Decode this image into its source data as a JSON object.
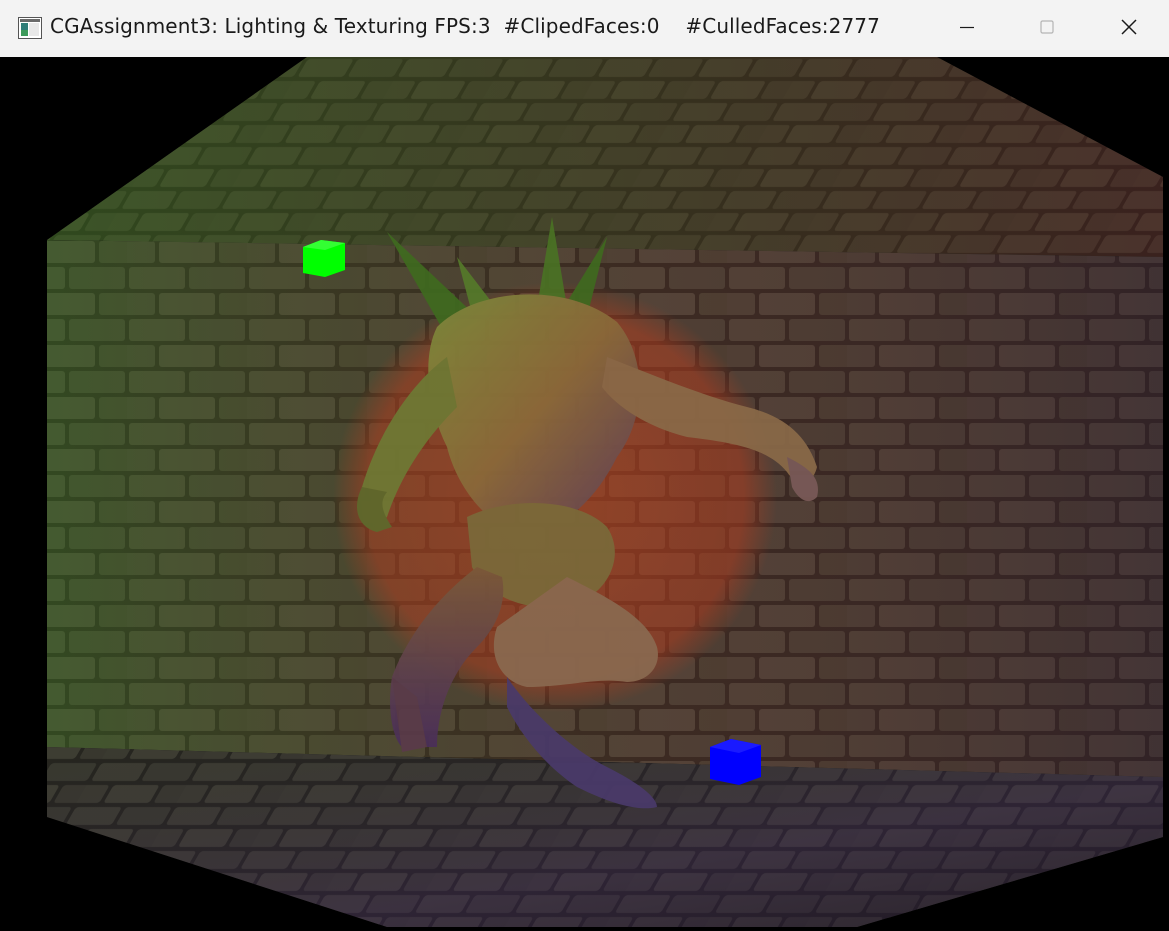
{
  "window": {
    "title": "CGAssignment3: Lighting & Texturing FPS:3  #ClipedFaces:0    #CulledFaces:2777",
    "app_icon": "window-app-icon",
    "controls": {
      "minimize_icon": "minimize-icon",
      "maximize_icon": "maximize-icon",
      "close_icon": "close-icon"
    }
  },
  "scene": {
    "background_color": "#000000",
    "wall_texture": "stone-brick",
    "model": "creature-model",
    "spotlight_color": "#c8461e",
    "lights": [
      {
        "name": "green-light-cube",
        "color": "#00ff00"
      },
      {
        "name": "blue-light-cube",
        "color": "#0000ff"
      }
    ],
    "colors": {
      "green_tint": "#3c6e1e",
      "red_tint": "#6e2a1e",
      "purple_tint": "#3a2450"
    }
  }
}
